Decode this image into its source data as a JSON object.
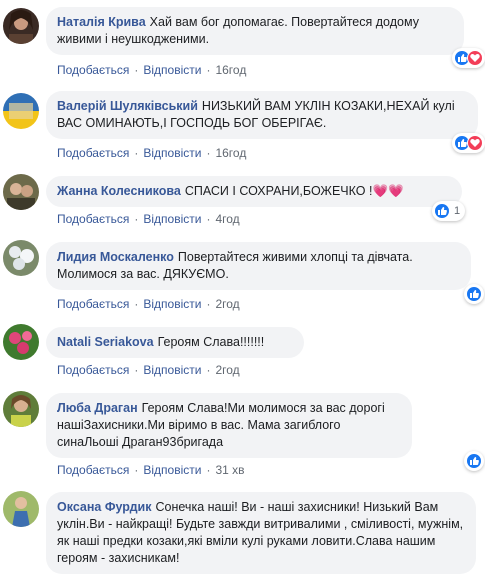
{
  "labels": {
    "like": "Подобається",
    "reply": "Відповісти",
    "dot": "·"
  },
  "comments": [
    {
      "author": "Наталія Крива",
      "text": "Хай вам бог допомагає. Повертайтеся додому живими і неушкодженими.",
      "time": "16год",
      "reactions": [
        "like",
        "love"
      ],
      "count": ""
    },
    {
      "author": "Валерій Шуляківський",
      "text": "НИЗЬКИЙ ВАМ УКЛІН КОЗАКИ,НЕХАЙ кулі ВАС ОМИНАЮТЬ,І ГОСПОДЬ БОГ ОБЕРІГАЄ.",
      "time": "16год",
      "reactions": [
        "like",
        "love"
      ],
      "count": ""
    },
    {
      "author": "Жанна Колесникова",
      "text": "СПАСИ І СОХРАНИ,БОЖЕЧКО !💗💗",
      "time": "4год",
      "reactions": [
        "like"
      ],
      "count": "1"
    },
    {
      "author": "Лидия Москаленко",
      "text": "Повертайтеся живими хлопці та дівчата. Молимося за вас. ДЯКУЄМО.",
      "time": "2год",
      "reactions": [
        "like"
      ],
      "count": ""
    },
    {
      "author": "Natali Seriakova",
      "text": "Героям Слава!!!!!!!",
      "time": "2год",
      "reactions": [],
      "count": ""
    },
    {
      "author": "Люба Драган",
      "text": "Героям Слава!Ми молимося за вас дорогі нашіЗахисники.Ми віримо в вас. Мама загиблого синаЛьоші Драган93бригада",
      "time": "31 хв",
      "reactions": [
        "like"
      ],
      "count": ""
    },
    {
      "author": "Оксана Фурдик",
      "text": "Сонечка наші! Ви - наші захисники! Низький Вам уклін.Ви - найкращі! Будьте завжди витривалими , сміливості, мужнім, як наші предки козаки,які вміли кулі руками ловити.Слава нашим героям - захисникам!",
      "time": "",
      "reactions": [],
      "count": ""
    }
  ],
  "colors": {
    "author": "#385898",
    "bubble": "#f2f3f5",
    "like": "#1877f2",
    "love": "#f33e58",
    "meta": "#606770"
  }
}
